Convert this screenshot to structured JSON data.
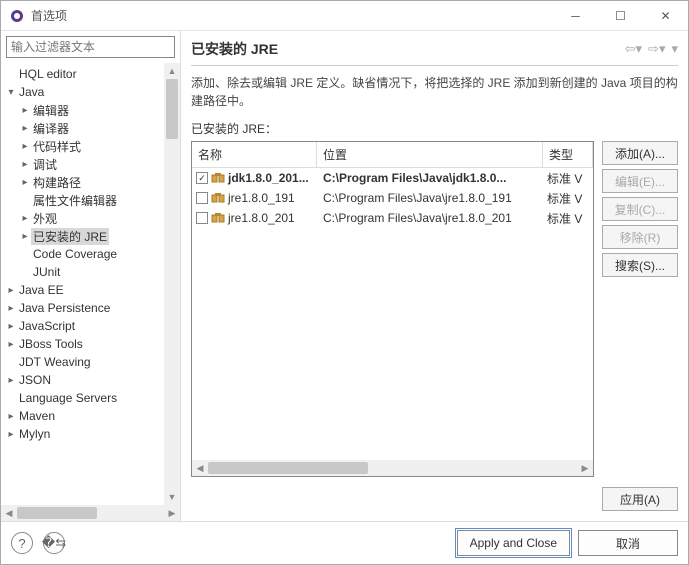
{
  "window": {
    "title": "首选项"
  },
  "filter": {
    "placeholder": "输入过滤器文本"
  },
  "tree": {
    "items": [
      {
        "label": "HQL editor",
        "depth": 0,
        "tw": "",
        "sel": false
      },
      {
        "label": "Java",
        "depth": 0,
        "tw": "▾",
        "sel": false
      },
      {
        "label": "编辑器",
        "depth": 1,
        "tw": "▸",
        "sel": false
      },
      {
        "label": "编译器",
        "depth": 1,
        "tw": "▸",
        "sel": false
      },
      {
        "label": "代码样式",
        "depth": 1,
        "tw": "▸",
        "sel": false
      },
      {
        "label": "调试",
        "depth": 1,
        "tw": "▸",
        "sel": false
      },
      {
        "label": "构建路径",
        "depth": 1,
        "tw": "▸",
        "sel": false
      },
      {
        "label": "属性文件编辑器",
        "depth": 1,
        "tw": "",
        "sel": false
      },
      {
        "label": "外观",
        "depth": 1,
        "tw": "▸",
        "sel": false
      },
      {
        "label": "已安装的 JRE",
        "depth": 1,
        "tw": "▸",
        "sel": true
      },
      {
        "label": "Code Coverage",
        "depth": 1,
        "tw": "",
        "sel": false
      },
      {
        "label": "JUnit",
        "depth": 1,
        "tw": "",
        "sel": false
      },
      {
        "label": "Java EE",
        "depth": 0,
        "tw": "▸",
        "sel": false
      },
      {
        "label": "Java Persistence",
        "depth": 0,
        "tw": "▸",
        "sel": false
      },
      {
        "label": "JavaScript",
        "depth": 0,
        "tw": "▸",
        "sel": false
      },
      {
        "label": "JBoss Tools",
        "depth": 0,
        "tw": "▸",
        "sel": false
      },
      {
        "label": "JDT Weaving",
        "depth": 0,
        "tw": "",
        "sel": false
      },
      {
        "label": "JSON",
        "depth": 0,
        "tw": "▸",
        "sel": false
      },
      {
        "label": "Language Servers",
        "depth": 0,
        "tw": "",
        "sel": false
      },
      {
        "label": "Maven",
        "depth": 0,
        "tw": "▸",
        "sel": false
      },
      {
        "label": "Mylyn",
        "depth": 0,
        "tw": "▸",
        "sel": false
      }
    ]
  },
  "page": {
    "heading": "已安装的 JRE",
    "desc": "添加、除去或编辑 JRE 定义。缺省情况下，将把选择的 JRE 添加到新创建的 Java 项目的构建路径中。",
    "listLabel": "已安装的 JRE：",
    "cols": {
      "name": "名称",
      "loc": "位置",
      "type": "类型"
    },
    "rows": [
      {
        "checked": true,
        "bold": true,
        "name": "jdk1.8.0_201...",
        "loc": "C:\\Program Files\\Java\\jdk1.8.0...",
        "type": "标准 V"
      },
      {
        "checked": false,
        "bold": false,
        "name": "jre1.8.0_191",
        "loc": "C:\\Program Files\\Java\\jre1.8.0_191",
        "type": "标准 V"
      },
      {
        "checked": false,
        "bold": false,
        "name": "jre1.8.0_201",
        "loc": "C:\\Program Files\\Java\\jre1.8.0_201",
        "type": "标准 V"
      }
    ]
  },
  "buttons": {
    "add": "添加(A)...",
    "edit": "编辑(E)...",
    "copy": "复制(C)...",
    "remove": "移除(R)",
    "search": "搜索(S)...",
    "apply": "应用(A)",
    "applyClose": "Apply and Close",
    "cancel": "取消"
  }
}
